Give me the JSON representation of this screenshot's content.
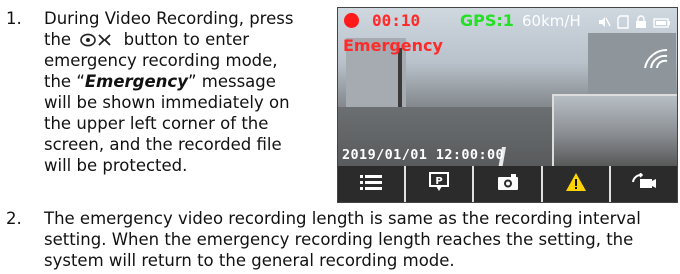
{
  "items": [
    {
      "number": "1.",
      "lines": [
        "During Video Recording, press",
        "button to enter",
        "emergency recording mode,",
        "the “",
        "Emergency",
        "” message",
        "will be shown immediately on",
        "the upper left corner of the",
        "screen, and the recorded file",
        "will be protected."
      ]
    },
    {
      "number": "2.",
      "lines": [
        "The emergency video recording length is same as the recording interval",
        "setting. When the emergency recording length reaches the setting, the",
        "system will return to the general recording mode."
      ]
    }
  ],
  "screen": {
    "timer": "00:10",
    "gps": "GPS:1",
    "speed": "60km/H",
    "emergency_label": "Emergency",
    "datetime": "2019/01/01 12:00:00",
    "colors": {
      "rec": "#ff1b1b",
      "gps": "#22e022",
      "warning": "#ffd400"
    },
    "toolbar_icons": [
      "menu-icon",
      "parking-camera-icon",
      "camera-icon",
      "warning-icon",
      "camera-switch-icon"
    ],
    "status_icons": [
      "mute-icon",
      "sd-card-icon",
      "lock-icon",
      "battery-icon",
      "wifi-icon"
    ]
  },
  "inline_icon": "emergency-button-icon"
}
